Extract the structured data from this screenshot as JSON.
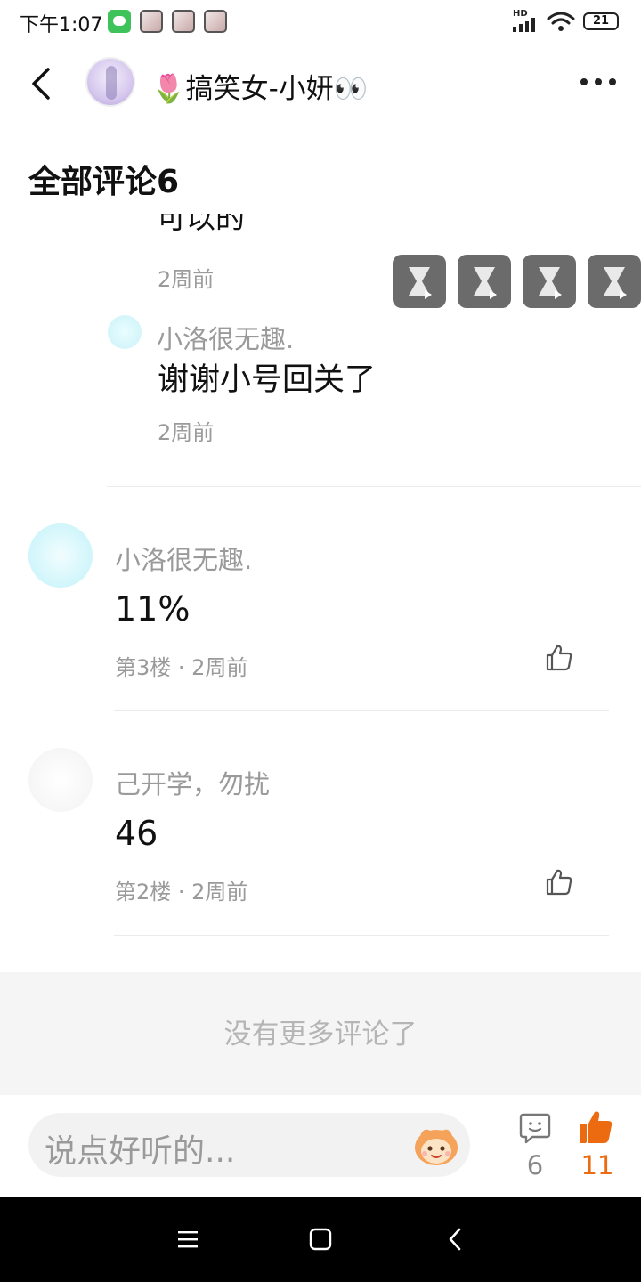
{
  "status_bar": {
    "time": "下午1:07",
    "network_label": "HD",
    "battery": "21",
    "notification_icons": [
      "wechat-icon",
      "app-notification-icon",
      "app-notification-icon",
      "app-notification-icon"
    ]
  },
  "header": {
    "title": "🌷搞笑女-小妍👀",
    "icons": [
      "back-icon",
      "avatar",
      "more-icon"
    ]
  },
  "section_title": "全部评论6",
  "partial_reply": {
    "clipped_text": "可以的",
    "time": "2周前"
  },
  "reply": {
    "username": "小洛很无趣.",
    "text": "谢谢小号回关了",
    "time": "2周前"
  },
  "comments": [
    {
      "username": "小洛很无趣.",
      "text": "11%",
      "meta": "第3楼 · 2周前",
      "avatar_color": "#cff5fa"
    },
    {
      "username": "己开学，勿扰",
      "text": "46",
      "meta": "第2楼 · 2周前",
      "avatar_color": "#f3f3f3"
    }
  ],
  "no_more_text": "没有更多评论了",
  "bottom_bar": {
    "input_placeholder": "说点好听的...",
    "comment_count": "6",
    "like_count": "11",
    "like_color": "#ec6a10"
  },
  "media_buttons": [
    "hourglass-video-icon",
    "hourglass-video-icon",
    "hourglass-video-icon",
    "hourglass-video-icon"
  ]
}
